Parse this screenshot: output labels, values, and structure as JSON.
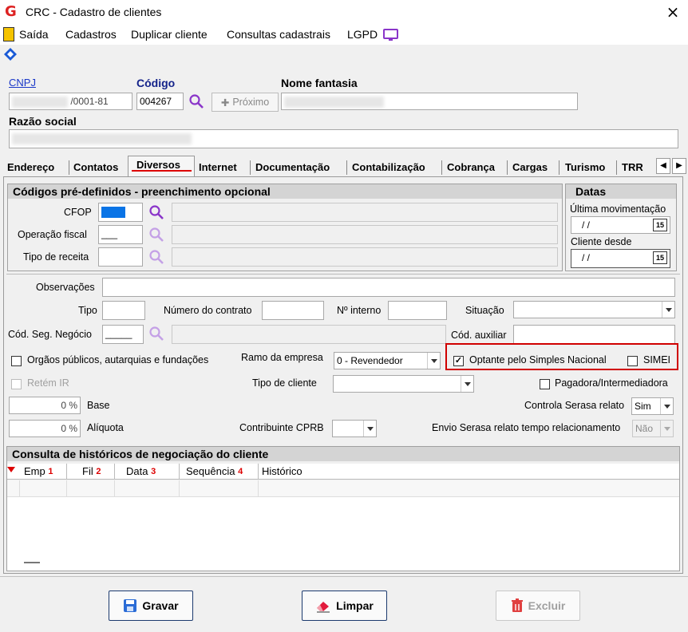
{
  "window": {
    "title": "CRC - Cadastro de clientes"
  },
  "menu": {
    "items": [
      "Saída",
      "Cadastros",
      "Duplicar cliente",
      "Consultas cadastrais",
      "LGPD"
    ]
  },
  "header": {
    "cnpj_label": "CNPJ",
    "cnpj_value": "/0001-81",
    "codigo_label": "Código",
    "codigo_value": "004267",
    "proximo_label": "Próximo",
    "nome_fantasia_label": "Nome fantasia",
    "razao_social_label": "Razão social"
  },
  "tabs": [
    "Endereço",
    "Contatos",
    "Diversos",
    "Internet",
    "Documentação",
    "Contabilização",
    "Cobrança",
    "Cargas",
    "Turismo",
    "TRR"
  ],
  "active_tab": "Diversos",
  "codigos": {
    "title": "Códigos pré-definidos - preenchimento opcional",
    "cfop_label": "CFOP",
    "operacao_label": "Operação fiscal",
    "operacao_value": "___",
    "tipo_receita_label": "Tipo de receita"
  },
  "datas": {
    "title": "Datas",
    "ultima_label": "Última movimentação",
    "ultima_value": "/ /",
    "cliente_desde_label": "Cliente desde",
    "cliente_desde_value": "/ /",
    "calendar_num": "15"
  },
  "form": {
    "observacoes_label": "Observações",
    "tipo_label": "Tipo",
    "numero_contrato_label": "Número do contrato",
    "n_interno_label": "Nº interno",
    "situacao_label": "Situação",
    "cod_seg_label": "Cód. Seg. Negócio",
    "cod_seg_value": "_____",
    "cod_auxiliar_label": "Cód. auxiliar",
    "orgaos_label": "Orgãos públicos, autarquias e fundações",
    "ramo_label": "Ramo da empresa",
    "ramo_value": "0 - Revendedor",
    "optante_label": "Optante pelo Simples Nacional",
    "optante_checked": true,
    "simei_label": "SIMEI",
    "retem_label": "Retém IR",
    "tipo_cliente_label": "Tipo de cliente",
    "pagadora_label": "Pagadora/Intermediadora",
    "base_value": "0 %",
    "base_label": "Base",
    "controla_label": "Controla Serasa relato",
    "controla_value": "Sim",
    "aliquota_value": "0 %",
    "aliquota_label": "Alíquota",
    "contribuinte_label": "Contribuinte CPRB",
    "envio_label": "Envio Serasa relato tempo relacionamento",
    "envio_value": "Não"
  },
  "consulta": {
    "title": "Consulta de históricos de negociação do cliente",
    "columns": [
      {
        "label": "Emp",
        "num": "1"
      },
      {
        "label": "Fil",
        "num": "2"
      },
      {
        "label": "Data",
        "num": "3"
      },
      {
        "label": "Sequência",
        "num": "4"
      },
      {
        "label": "Histórico",
        "num": ""
      }
    ]
  },
  "buttons": {
    "gravar": "Gravar",
    "limpar": "Limpar",
    "excluir": "Excluir"
  },
  "colors": {
    "highlight": "#d00000",
    "accent": "#1a38c8",
    "magnifier": "#8a35c9"
  }
}
